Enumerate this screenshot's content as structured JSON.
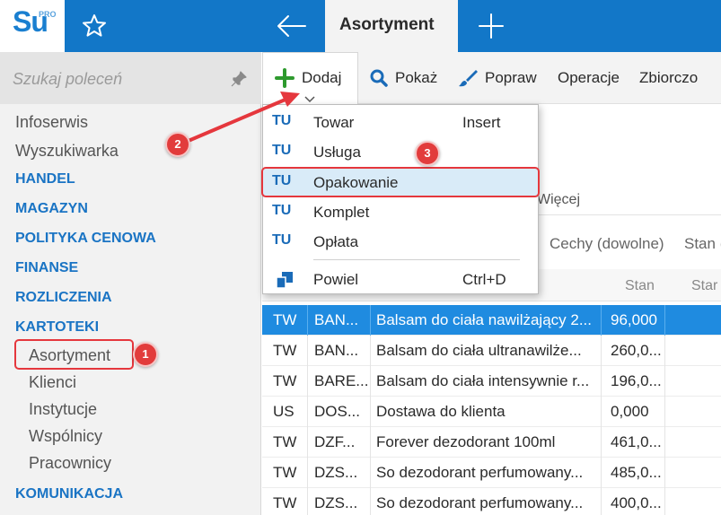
{
  "app": {
    "logo_text": "Su",
    "logo_badge": "PRO",
    "active_tab": "Asortyment"
  },
  "sidebar": {
    "search_placeholder": "Szukaj poleceń",
    "items": {
      "infoserwis": "Infoserwis",
      "wyszukiwarka": "Wyszukiwarka",
      "handel": "HANDEL",
      "magazyn": "MAGAZYN",
      "polityka": "POLITYKA CENOWA",
      "finanse": "FINANSE",
      "rozliczenia": "ROZLICZENIA",
      "kartoteki": "KARTOTEKI",
      "asortyment": "Asortyment",
      "klienci": "Klienci",
      "instytucje": "Instytucje",
      "wspolnicy": "Wspólnicy",
      "pracownicy": "Pracownicy",
      "komunikacja": "KOMUNIKACJA"
    }
  },
  "toolbar": {
    "dodaj": "Dodaj",
    "pokaz": "Pokaż",
    "popraw": "Popraw",
    "operacje": "Operacje",
    "zbiorczo": "Zbiorczo"
  },
  "dropdown": {
    "items": [
      {
        "icon": "TU",
        "label": "Towar",
        "shortcut": "Insert"
      },
      {
        "icon": "TU",
        "label": "Usługa",
        "shortcut": ""
      },
      {
        "icon": "TU",
        "label": "Opakowanie",
        "shortcut": ""
      },
      {
        "icon": "TU",
        "label": "Komplet",
        "shortcut": ""
      },
      {
        "icon": "TU",
        "label": "Opłata",
        "shortcut": ""
      },
      {
        "icon": "",
        "label": "Powiel",
        "shortcut": "Ctrl+D"
      }
    ]
  },
  "content": {
    "more_tab": "Więcej",
    "filter_cechy": "Cechy (dowolne)",
    "filter_stan": "Stan (",
    "col_stan": "Stan",
    "col_stan2": "Star"
  },
  "rows": [
    {
      "typ": "TW",
      "kod": "BAN...",
      "nazwa": "Balsam do ciała nawilżający 2...",
      "stan": "96,000",
      "selected": true
    },
    {
      "typ": "TW",
      "kod": "BAN...",
      "nazwa": "Balsam do ciała ultranawilże...",
      "stan": "260,0...",
      "selected": false
    },
    {
      "typ": "TW",
      "kod": "BARE...",
      "nazwa": "Balsam do ciała intensywnie r...",
      "stan": "196,0...",
      "selected": false
    },
    {
      "typ": "US",
      "kod": "DOS...",
      "nazwa": "Dostawa do klienta",
      "stan": "0,000",
      "selected": false
    },
    {
      "typ": "TW",
      "kod": "DZF...",
      "nazwa": "Forever dezodorant 100ml",
      "stan": "461,0...",
      "selected": false
    },
    {
      "typ": "TW",
      "kod": "DZS...",
      "nazwa": "So dezodorant perfumowany...",
      "stan": "485,0...",
      "selected": false
    },
    {
      "typ": "TW",
      "kod": "DZS...",
      "nazwa": "So dezodorant perfumowany...",
      "stan": "400,0...",
      "selected": false
    }
  ],
  "annotations": {
    "step1": "1",
    "step2": "2",
    "step3": "3"
  },
  "colors": {
    "brand_blue": "#1277c8",
    "selection_blue": "#1f8be0",
    "annotation_red": "#e5373d"
  }
}
